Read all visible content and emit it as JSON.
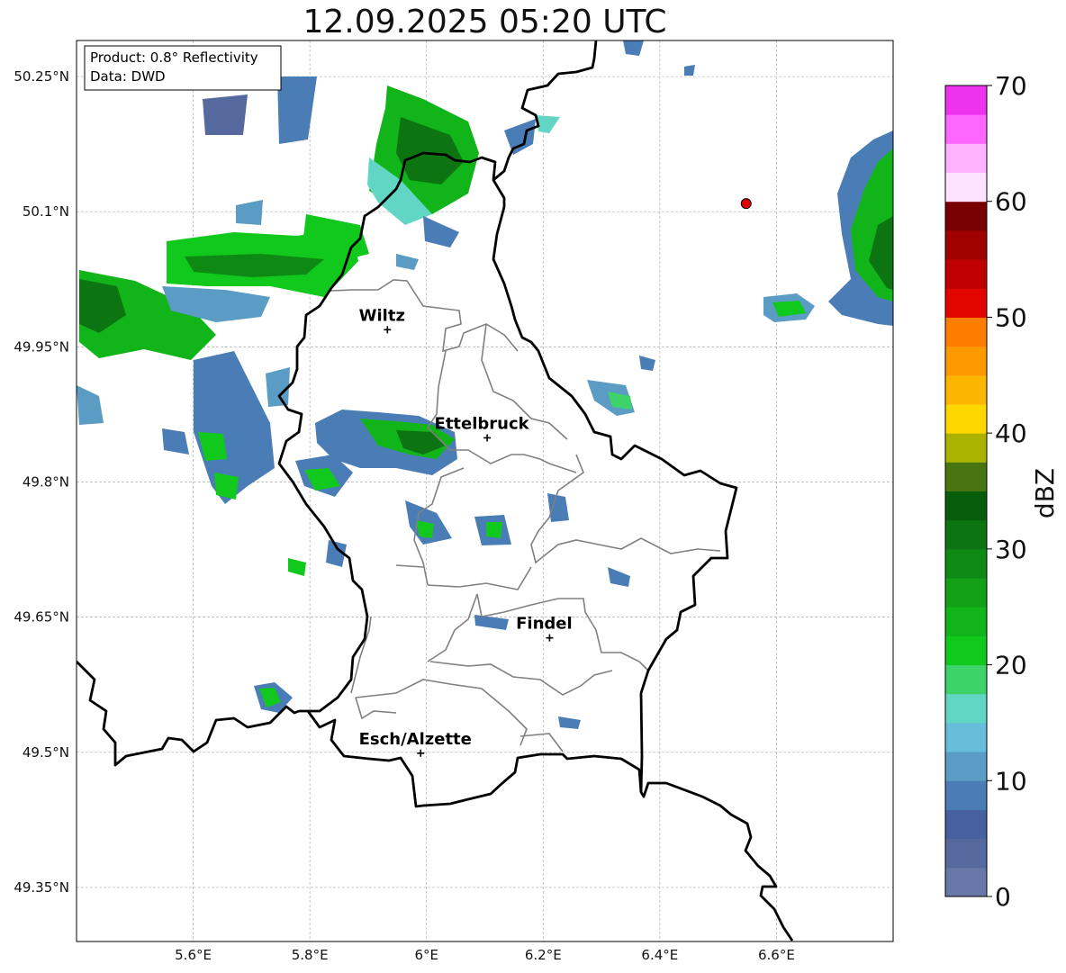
{
  "title": "12.09.2025 05:20 UTC",
  "info_box": {
    "line1": "Product: 0.8° Reflectivity",
    "line2": "Data: DWD"
  },
  "map": {
    "lon_range": [
      5.4,
      6.8
    ],
    "lat_range": [
      49.29,
      50.29
    ],
    "lat_ticks": [
      {
        "value": 50.25,
        "label": "50.25°N"
      },
      {
        "value": 50.1,
        "label": "50.1°N"
      },
      {
        "value": 49.95,
        "label": "49.95°N"
      },
      {
        "value": 49.8,
        "label": "49.8°N"
      },
      {
        "value": 49.65,
        "label": "49.65°N"
      },
      {
        "value": 49.5,
        "label": "49.5°N"
      },
      {
        "value": 49.35,
        "label": "49.35°N"
      }
    ],
    "lon_ticks": [
      {
        "value": 5.6,
        "label": "5.6°E"
      },
      {
        "value": 5.8,
        "label": "5.8°E"
      },
      {
        "value": 6.0,
        "label": "6°E"
      },
      {
        "value": 6.2,
        "label": "6.2°E"
      },
      {
        "value": 6.4,
        "label": "6.4°E"
      },
      {
        "value": 6.6,
        "label": "6.6°E"
      }
    ],
    "gridlines": true,
    "cities": [
      {
        "name": "Wiltz",
        "lon": 5.933,
        "lat": 49.969
      },
      {
        "name": "Ettelbruck",
        "lon": 6.104,
        "lat": 49.849
      },
      {
        "name": "Findel",
        "lon": 6.211,
        "lat": 49.627
      },
      {
        "name": "Esch/Alzette",
        "lon": 5.99,
        "lat": 49.499
      }
    ],
    "radar_site": {
      "lon": 6.548,
      "lat": 50.109,
      "color": "#e00000"
    }
  },
  "colorbar": {
    "label": "dBZ",
    "min": 0,
    "max": 70,
    "step": 2.5,
    "ticks": [
      {
        "value": 0,
        "label": "0"
      },
      {
        "value": 10,
        "label": "10"
      },
      {
        "value": 20,
        "label": "20"
      },
      {
        "value": 30,
        "label": "30"
      },
      {
        "value": 40,
        "label": "40"
      },
      {
        "value": 50,
        "label": "50"
      },
      {
        "value": 60,
        "label": "60"
      },
      {
        "value": 70,
        "label": "70"
      }
    ],
    "colors": [
      "#6777a8",
      "#56699f",
      "#4660a0",
      "#4a7db5",
      "#5a9cc4",
      "#66bedb",
      "#62d6c4",
      "#3dd36a",
      "#11c81c",
      "#11b51a",
      "#12a016",
      "#0e8a14",
      "#0c7410",
      "#075c0c",
      "#487510",
      "#aab300",
      "#fed700",
      "#fdb500",
      "#fd9800",
      "#fe7c00",
      "#e10600",
      "#c00000",
      "#a00000",
      "#780000",
      "#ffe2ff",
      "#ffb3ff",
      "#ff66ff",
      "#ee33ee"
    ]
  }
}
